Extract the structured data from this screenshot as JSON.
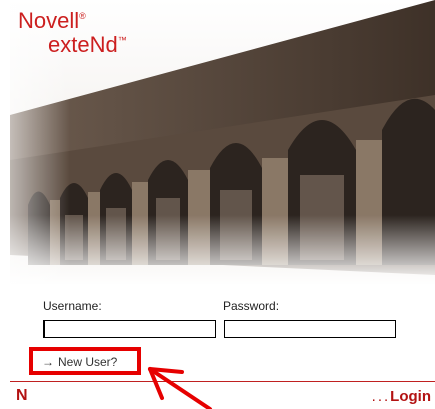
{
  "brand": {
    "line1": "Novell",
    "line1_mark": "®",
    "line2": "exteNd",
    "line2_mark": "™"
  },
  "form": {
    "username_label": "Username:",
    "password_label": "Password:",
    "username_value": "",
    "password_value": ""
  },
  "links": {
    "new_user_arrow": "→",
    "new_user_label": "New User?",
    "login_prefix": "...",
    "login_label": "Login"
  },
  "footer": {
    "logo": "N"
  },
  "colors": {
    "brand_red": "#cc1f1f",
    "annotation_red": "#e60000",
    "footer_red": "#b31212"
  }
}
